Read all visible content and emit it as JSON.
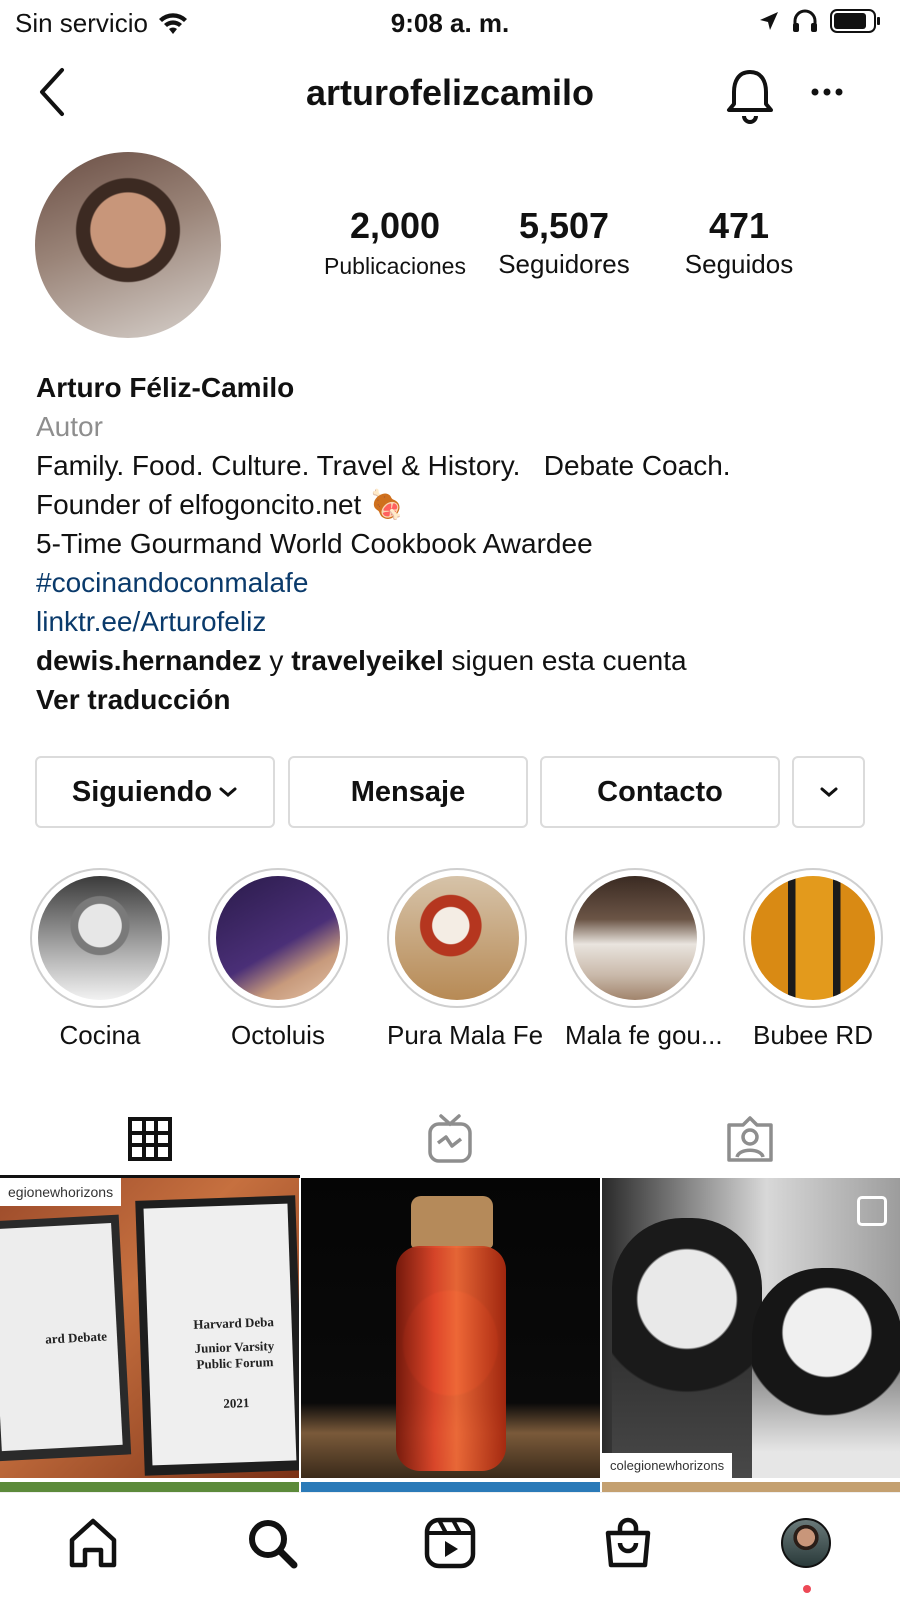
{
  "status_bar": {
    "carrier": "Sin servicio",
    "time": "9:08 a. m."
  },
  "header": {
    "username": "arturofelizcamilo"
  },
  "stats": [
    {
      "value": "2,000",
      "label": "Publicaciones"
    },
    {
      "value": "5,507",
      "label": "Seguidores"
    },
    {
      "value": "471",
      "label": "Seguidos"
    }
  ],
  "bio": {
    "name": "Arturo Féliz-Camilo",
    "category": "Autor",
    "line1": "Family. Food. Culture. Travel & History.   Debate Coach.",
    "line2": "Founder of elfogoncito.net 🍖",
    "line3": "5-Time Gourmand World Cookbook Awardee",
    "hashtag": "#cocinandoconmalafe",
    "link": "linktr.ee/Arturofeliz",
    "followed_by_1": "dewis.hernandez",
    "followed_by_joiner": "y",
    "followed_by_2": "travelyeikel",
    "followed_by_suffix": "siguen esta cuenta",
    "translate": "Ver traducción"
  },
  "buttons": {
    "following": "Siguiendo",
    "message": "Mensaje",
    "contact": "Contacto"
  },
  "highlights": [
    {
      "label": "Cocina"
    },
    {
      "label": "Octoluis"
    },
    {
      "label": "Pura Mala Fe"
    },
    {
      "label": "Mala fe gou..."
    },
    {
      "label": "Bubee RD"
    }
  ],
  "posts": [
    {
      "watermark": "egionewhorizons",
      "plaque_left": "ard Debate",
      "plaque_right": "Harvard Deba",
      "plaque_sub": "Junior Varsity",
      "plaque_sub2": "Public Forum",
      "year": "2021"
    },
    {
      "caption": ""
    },
    {
      "watermark": "colegionewhorizons"
    }
  ],
  "colors": {
    "link": "#0a3a6b",
    "notification_dot": "#ed4956",
    "border": "#dbdbdb"
  },
  "icons": [
    "back-arrow-icon",
    "bell-icon",
    "more-icon",
    "grid-icon",
    "igtv-icon",
    "tagged-icon",
    "home-icon",
    "search-icon",
    "reels-icon",
    "shop-icon"
  ]
}
